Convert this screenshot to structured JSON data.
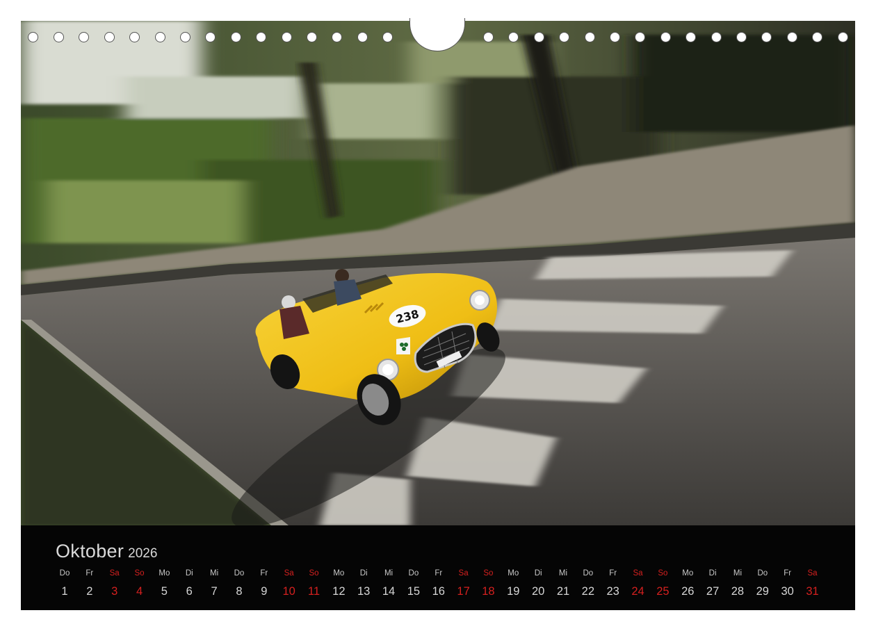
{
  "calendar": {
    "month": "Oktober",
    "year": "2026",
    "weekend_color": "#d5201f",
    "days": [
      {
        "dow": "Do",
        "num": "1",
        "weekend": false
      },
      {
        "dow": "Fr",
        "num": "2",
        "weekend": false
      },
      {
        "dow": "Sa",
        "num": "3",
        "weekend": true
      },
      {
        "dow": "So",
        "num": "4",
        "weekend": true
      },
      {
        "dow": "Mo",
        "num": "5",
        "weekend": false
      },
      {
        "dow": "Di",
        "num": "6",
        "weekend": false
      },
      {
        "dow": "Mi",
        "num": "7",
        "weekend": false
      },
      {
        "dow": "Do",
        "num": "8",
        "weekend": false
      },
      {
        "dow": "Fr",
        "num": "9",
        "weekend": false
      },
      {
        "dow": "Sa",
        "num": "10",
        "weekend": true
      },
      {
        "dow": "So",
        "num": "11",
        "weekend": true
      },
      {
        "dow": "Mo",
        "num": "12",
        "weekend": false
      },
      {
        "dow": "Di",
        "num": "13",
        "weekend": false
      },
      {
        "dow": "Mi",
        "num": "14",
        "weekend": false
      },
      {
        "dow": "Do",
        "num": "15",
        "weekend": false
      },
      {
        "dow": "Fr",
        "num": "16",
        "weekend": false
      },
      {
        "dow": "Sa",
        "num": "17",
        "weekend": true
      },
      {
        "dow": "So",
        "num": "18",
        "weekend": true
      },
      {
        "dow": "Mo",
        "num": "19",
        "weekend": false
      },
      {
        "dow": "Di",
        "num": "20",
        "weekend": false
      },
      {
        "dow": "Mi",
        "num": "21",
        "weekend": false
      },
      {
        "dow": "Do",
        "num": "22",
        "weekend": false
      },
      {
        "dow": "Fr",
        "num": "23",
        "weekend": false
      },
      {
        "dow": "Sa",
        "num": "24",
        "weekend": true
      },
      {
        "dow": "So",
        "num": "25",
        "weekend": true
      },
      {
        "dow": "Mo",
        "num": "26",
        "weekend": false
      },
      {
        "dow": "Di",
        "num": "27",
        "weekend": false
      },
      {
        "dow": "Mi",
        "num": "28",
        "weekend": false
      },
      {
        "dow": "Do",
        "num": "29",
        "weekend": false
      },
      {
        "dow": "Fr",
        "num": "30",
        "weekend": false
      },
      {
        "dow": "Sa",
        "num": "31",
        "weekend": true
      }
    ]
  },
  "photo": {
    "race_number": "238",
    "car_color": "#f0c21a"
  }
}
